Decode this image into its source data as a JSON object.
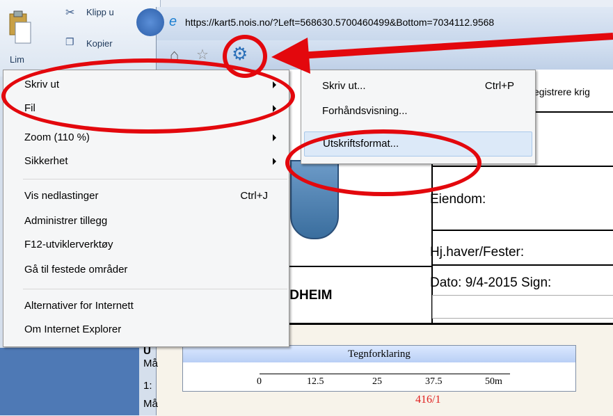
{
  "ribbon": {
    "paste": "Lim",
    "cut": "Klipp u",
    "copy": "Kopier"
  },
  "browser": {
    "url": "https://kart5.nois.no/?Left=568630.5700460499&Bottom=7034112.9568"
  },
  "menu": {
    "items": [
      {
        "label": "Skriv ut",
        "shortcut": "",
        "submenu": true
      },
      {
        "label": "Fil",
        "shortcut": "",
        "submenu": true
      },
      {
        "label": "Zoom (110 %)",
        "shortcut": "",
        "submenu": true
      },
      {
        "label": "Sikkerhet",
        "shortcut": "",
        "submenu": true
      },
      {
        "label": "Vis nedlastinger",
        "shortcut": "Ctrl+J",
        "submenu": false
      },
      {
        "label": "Administrer tillegg",
        "shortcut": "",
        "submenu": false
      },
      {
        "label": "F12-utviklerverktøy",
        "shortcut": "",
        "submenu": false
      },
      {
        "label": "Gå til festede områder",
        "shortcut": "",
        "submenu": false
      },
      {
        "label": "Alternativer for Internett",
        "shortcut": "",
        "submenu": false
      },
      {
        "label": "Om Internet Explorer",
        "shortcut": "",
        "submenu": false
      }
    ]
  },
  "submenu": {
    "items": [
      {
        "label": "Skriv ut...",
        "shortcut": "Ctrl+P"
      },
      {
        "label": "Forhåndsvisning...",
        "shortcut": ""
      },
      {
        "label": "Utskriftsformat...",
        "shortcut": ""
      }
    ]
  },
  "document": {
    "header_right": "egistrere krig",
    "eiendom": "Eiendom:",
    "fester": "Hj.haver/Fester:",
    "dato": "Dato: 9/4-2015   Sign:",
    "city": "IDHEIM",
    "map_label": "416/1",
    "side_labels": [
      "U",
      "Må",
      "1:",
      "Må"
    ]
  },
  "legend": {
    "title": "Tegnforklaring",
    "ticks": [
      "0",
      "12.5",
      "25",
      "37.5",
      "50m"
    ]
  },
  "colors": {
    "annotation": "#e3080d",
    "highlight": "#dce9f8"
  }
}
